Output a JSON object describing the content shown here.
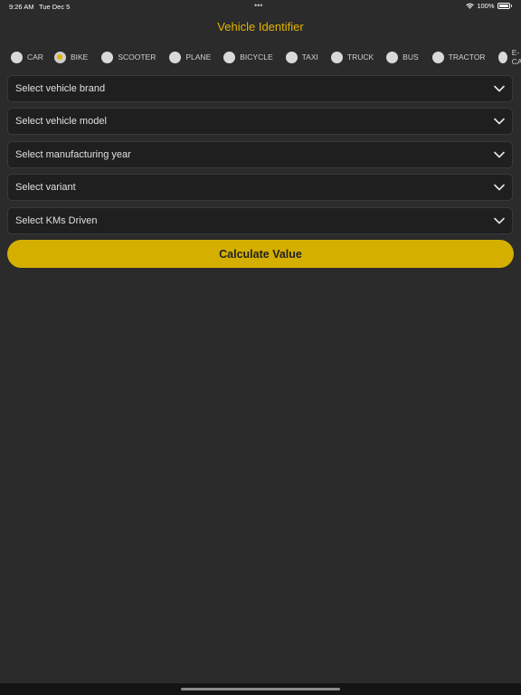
{
  "status_bar": {
    "time": "9:26 AM",
    "date": "Tue Dec 5",
    "battery": "100%",
    "dots": "•••"
  },
  "app": {
    "title": "Vehicle Identifier",
    "accent_color": "#e3b400"
  },
  "vehicle_types": {
    "selected": "BIKE",
    "options": [
      "CAR",
      "BIKE",
      "SCOOTER",
      "PLANE",
      "BICYCLE",
      "TAXI",
      "TRUCK",
      "BUS",
      "TRACTOR",
      "E-CAR"
    ]
  },
  "dropdowns": {
    "brand": "Select vehicle brand",
    "model": "Select vehicle model",
    "year": "Select manufacturing year",
    "variant": "Select variant",
    "kms": "Select KMs Driven"
  },
  "calculate_button": {
    "label": "Calculate Value",
    "color": "#d4af00"
  }
}
